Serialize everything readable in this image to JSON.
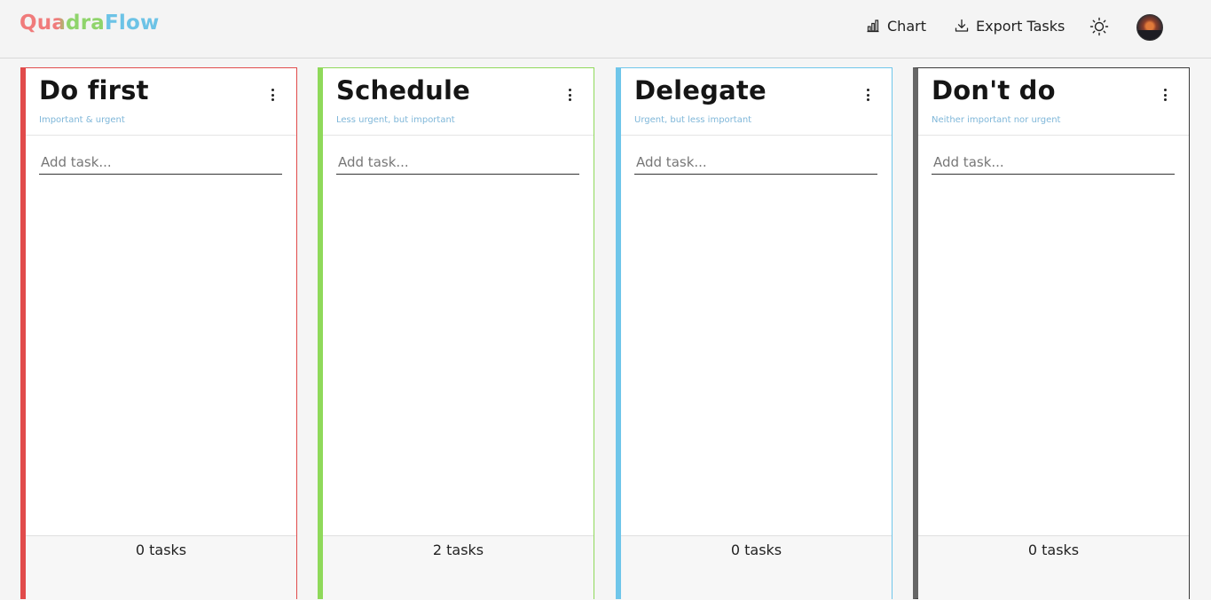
{
  "app": {
    "logo": {
      "part1": "Quadra",
      "part2": "Flow"
    },
    "colors": {
      "logo_part1": "#f07b7b",
      "logo_part1b": "#8fd46b",
      "logo_part2": "#6cc3e6"
    }
  },
  "header": {
    "chart_label": "Chart",
    "chart_icon": "bar-chart-icon",
    "export_label": "Export Tasks",
    "export_icon": "download-icon",
    "theme_icon": "sun-icon",
    "avatar_icon": "user-avatar"
  },
  "quadrants": [
    {
      "title": "Do first",
      "subtitle": "Important & urgent",
      "placeholder": "Add task...",
      "count": "0 tasks",
      "color": "#e14b4b"
    },
    {
      "title": "Schedule",
      "subtitle": "Less urgent, but important",
      "placeholder": "Add task...",
      "count": "2 tasks",
      "color": "#8fd95a"
    },
    {
      "title": "Delegate",
      "subtitle": "Urgent, but less important",
      "placeholder": "Add task...",
      "count": "0 tasks",
      "color": "#6fc6ea"
    },
    {
      "title": "Don't do",
      "subtitle": "Neither important nor urgent",
      "placeholder": "Add task...",
      "count": "0 tasks",
      "color": "#666666"
    }
  ]
}
